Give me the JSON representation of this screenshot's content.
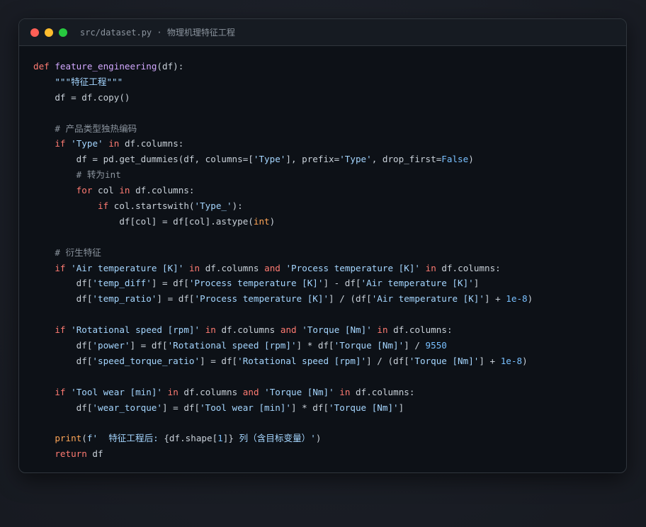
{
  "window": {
    "title": "src/dataset.py · 物理机理特征工程"
  },
  "code_lines": [
    [
      [
        "kw",
        "def"
      ],
      [
        "txt",
        " "
      ],
      [
        "fn",
        "feature_engineering"
      ],
      [
        "txt",
        "(df):"
      ]
    ],
    [
      [
        "txt",
        "    "
      ],
      [
        "str",
        "\"\"\"特征工程\"\"\""
      ]
    ],
    [
      [
        "txt",
        "    df = df.copy()"
      ]
    ],
    [],
    [
      [
        "txt",
        "    "
      ],
      [
        "cm",
        "# 产品类型独热编码"
      ]
    ],
    [
      [
        "txt",
        "    "
      ],
      [
        "kw",
        "if"
      ],
      [
        "txt",
        " "
      ],
      [
        "str",
        "'Type'"
      ],
      [
        "txt",
        " "
      ],
      [
        "kw",
        "in"
      ],
      [
        "txt",
        " df.columns:"
      ]
    ],
    [
      [
        "txt",
        "        df = pd.get_dummies(df, columns=["
      ],
      [
        "str",
        "'Type'"
      ],
      [
        "txt",
        "], prefix="
      ],
      [
        "str",
        "'Type'"
      ],
      [
        "txt",
        ", drop_first="
      ],
      [
        "num",
        "False"
      ],
      [
        "txt",
        ")"
      ]
    ],
    [
      [
        "txt",
        "        "
      ],
      [
        "cm",
        "# 转为int"
      ]
    ],
    [
      [
        "txt",
        "        "
      ],
      [
        "kw",
        "for"
      ],
      [
        "txt",
        " col "
      ],
      [
        "kw",
        "in"
      ],
      [
        "txt",
        " df.columns:"
      ]
    ],
    [
      [
        "txt",
        "            "
      ],
      [
        "kw",
        "if"
      ],
      [
        "txt",
        " col.startswith("
      ],
      [
        "str",
        "'Type_'"
      ],
      [
        "txt",
        "):"
      ]
    ],
    [
      [
        "txt",
        "                df[col] = df[col].astype("
      ],
      [
        "bi",
        "int"
      ],
      [
        "txt",
        ")"
      ]
    ],
    [],
    [
      [
        "txt",
        "    "
      ],
      [
        "cm",
        "# 衍生特征"
      ]
    ],
    [
      [
        "txt",
        "    "
      ],
      [
        "kw",
        "if"
      ],
      [
        "txt",
        " "
      ],
      [
        "str",
        "'Air temperature [K]'"
      ],
      [
        "txt",
        " "
      ],
      [
        "kw",
        "in"
      ],
      [
        "txt",
        " df.columns "
      ],
      [
        "kw",
        "and"
      ],
      [
        "txt",
        " "
      ],
      [
        "str",
        "'Process temperature [K]'"
      ],
      [
        "txt",
        " "
      ],
      [
        "kw",
        "in"
      ],
      [
        "txt",
        " df.columns:"
      ]
    ],
    [
      [
        "txt",
        "        df["
      ],
      [
        "str",
        "'temp_diff'"
      ],
      [
        "txt",
        "] = df["
      ],
      [
        "str",
        "'Process temperature [K]'"
      ],
      [
        "txt",
        "] - df["
      ],
      [
        "str",
        "'Air temperature [K]'"
      ],
      [
        "txt",
        "]"
      ]
    ],
    [
      [
        "txt",
        "        df["
      ],
      [
        "str",
        "'temp_ratio'"
      ],
      [
        "txt",
        "] = df["
      ],
      [
        "str",
        "'Process temperature [K]'"
      ],
      [
        "txt",
        "] / (df["
      ],
      [
        "str",
        "'Air temperature [K]'"
      ],
      [
        "txt",
        "] + "
      ],
      [
        "num",
        "1e-8"
      ],
      [
        "txt",
        ")"
      ]
    ],
    [],
    [
      [
        "txt",
        "    "
      ],
      [
        "kw",
        "if"
      ],
      [
        "txt",
        " "
      ],
      [
        "str",
        "'Rotational speed [rpm]'"
      ],
      [
        "txt",
        " "
      ],
      [
        "kw",
        "in"
      ],
      [
        "txt",
        " df.columns "
      ],
      [
        "kw",
        "and"
      ],
      [
        "txt",
        " "
      ],
      [
        "str",
        "'Torque [Nm]'"
      ],
      [
        "txt",
        " "
      ],
      [
        "kw",
        "in"
      ],
      [
        "txt",
        " df.columns:"
      ]
    ],
    [
      [
        "txt",
        "        df["
      ],
      [
        "str",
        "'power'"
      ],
      [
        "txt",
        "] = df["
      ],
      [
        "str",
        "'Rotational speed [rpm]'"
      ],
      [
        "txt",
        "] * df["
      ],
      [
        "str",
        "'Torque [Nm]'"
      ],
      [
        "txt",
        "] / "
      ],
      [
        "num",
        "9550"
      ]
    ],
    [
      [
        "txt",
        "        df["
      ],
      [
        "str",
        "'speed_torque_ratio'"
      ],
      [
        "txt",
        "] = df["
      ],
      [
        "str",
        "'Rotational speed [rpm]'"
      ],
      [
        "txt",
        "] / (df["
      ],
      [
        "str",
        "'Torque [Nm]'"
      ],
      [
        "txt",
        "] + "
      ],
      [
        "num",
        "1e-8"
      ],
      [
        "txt",
        ")"
      ]
    ],
    [],
    [
      [
        "txt",
        "    "
      ],
      [
        "kw",
        "if"
      ],
      [
        "txt",
        " "
      ],
      [
        "str",
        "'Tool wear [min]'"
      ],
      [
        "txt",
        " "
      ],
      [
        "kw",
        "in"
      ],
      [
        "txt",
        " df.columns "
      ],
      [
        "kw",
        "and"
      ],
      [
        "txt",
        " "
      ],
      [
        "str",
        "'Torque [Nm]'"
      ],
      [
        "txt",
        " "
      ],
      [
        "kw",
        "in"
      ],
      [
        "txt",
        " df.columns:"
      ]
    ],
    [
      [
        "txt",
        "        df["
      ],
      [
        "str",
        "'wear_torque'"
      ],
      [
        "txt",
        "] = df["
      ],
      [
        "str",
        "'Tool wear [min]'"
      ],
      [
        "txt",
        "] * df["
      ],
      [
        "str",
        "'Torque [Nm]'"
      ],
      [
        "txt",
        "]"
      ]
    ],
    [],
    [
      [
        "txt",
        "    "
      ],
      [
        "bi",
        "print"
      ],
      [
        "txt",
        "("
      ],
      [
        "str",
        "f'  特征工程后: "
      ],
      [
        "txt",
        "{df.shape["
      ],
      [
        "num",
        "1"
      ],
      [
        "txt",
        "]}"
      ],
      [
        "str",
        " 列（含目标变量）'"
      ],
      [
        "txt",
        ")"
      ]
    ],
    [
      [
        "txt",
        "    "
      ],
      [
        "kw",
        "return"
      ],
      [
        "txt",
        " df"
      ]
    ]
  ],
  "colors": {
    "keyword": "#ff7b72",
    "function": "#d2a8ff",
    "string": "#a5d6ff",
    "comment": "#8b949e",
    "number": "#79c0ff",
    "builtin": "#ffa657",
    "text": "#c9d1d9",
    "background": "#0d1117"
  }
}
